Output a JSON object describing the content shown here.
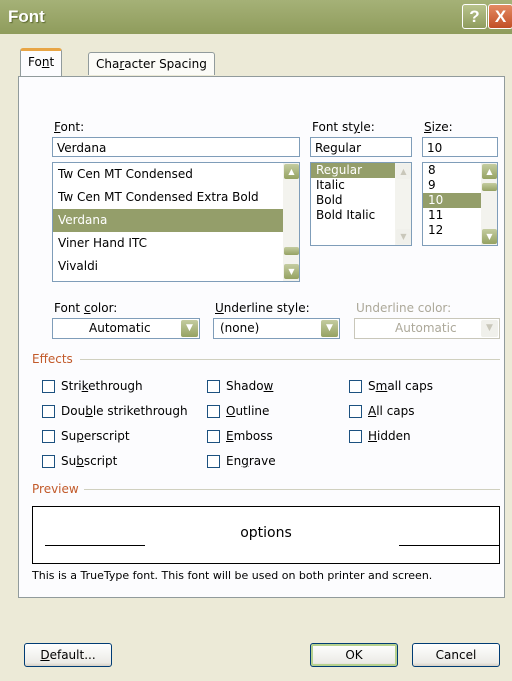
{
  "window": {
    "title": "Font",
    "help_label": "?",
    "close_label": "X"
  },
  "tabs": [
    {
      "label": "Font",
      "active": true
    },
    {
      "label": "Character Spacing",
      "active": false
    }
  ],
  "font": {
    "label": "Font:",
    "value": "Verdana",
    "items": [
      "Tw Cen MT Condensed",
      "Tw Cen MT Condensed Extra Bold",
      "Verdana",
      "Viner Hand ITC",
      "Vivaldi"
    ],
    "selected_index": 2
  },
  "font_style": {
    "label": "Font style:",
    "value": "Regular",
    "items": [
      "Regular",
      "Italic",
      "Bold",
      "Bold Italic"
    ],
    "selected_index": 0
  },
  "size": {
    "label": "Size:",
    "value": "10",
    "items": [
      "8",
      "9",
      "10",
      "11",
      "12"
    ],
    "selected_index": 2
  },
  "font_color": {
    "label": "Font color:",
    "value": "Automatic"
  },
  "underline_style": {
    "label": "Underline style:",
    "value": "(none)"
  },
  "underline_color": {
    "label": "Underline color:",
    "value": "Automatic",
    "disabled": true
  },
  "effects": {
    "label": "Effects",
    "checkboxes": [
      {
        "label": "Strikethrough",
        "checked": false
      },
      {
        "label": "Double strikethrough",
        "checked": false
      },
      {
        "label": "Superscript",
        "checked": false
      },
      {
        "label": "Subscript",
        "checked": false
      },
      {
        "label": "Shadow",
        "checked": false
      },
      {
        "label": "Outline",
        "checked": false
      },
      {
        "label": "Emboss",
        "checked": false
      },
      {
        "label": "Engrave",
        "checked": false
      },
      {
        "label": "Small caps",
        "checked": false
      },
      {
        "label": "All caps",
        "checked": false
      },
      {
        "label": "Hidden",
        "checked": false
      }
    ]
  },
  "preview": {
    "label": "Preview",
    "text": "options",
    "note": "This is a TrueType font. This font will be used on both printer and screen."
  },
  "buttons": {
    "default": "Default...",
    "ok": "OK",
    "cancel": "Cancel"
  },
  "colors": {
    "accent": "#949e6a",
    "titlebar": "#9aa66a",
    "group_label": "#c25a2a",
    "close": "#d2643a"
  }
}
